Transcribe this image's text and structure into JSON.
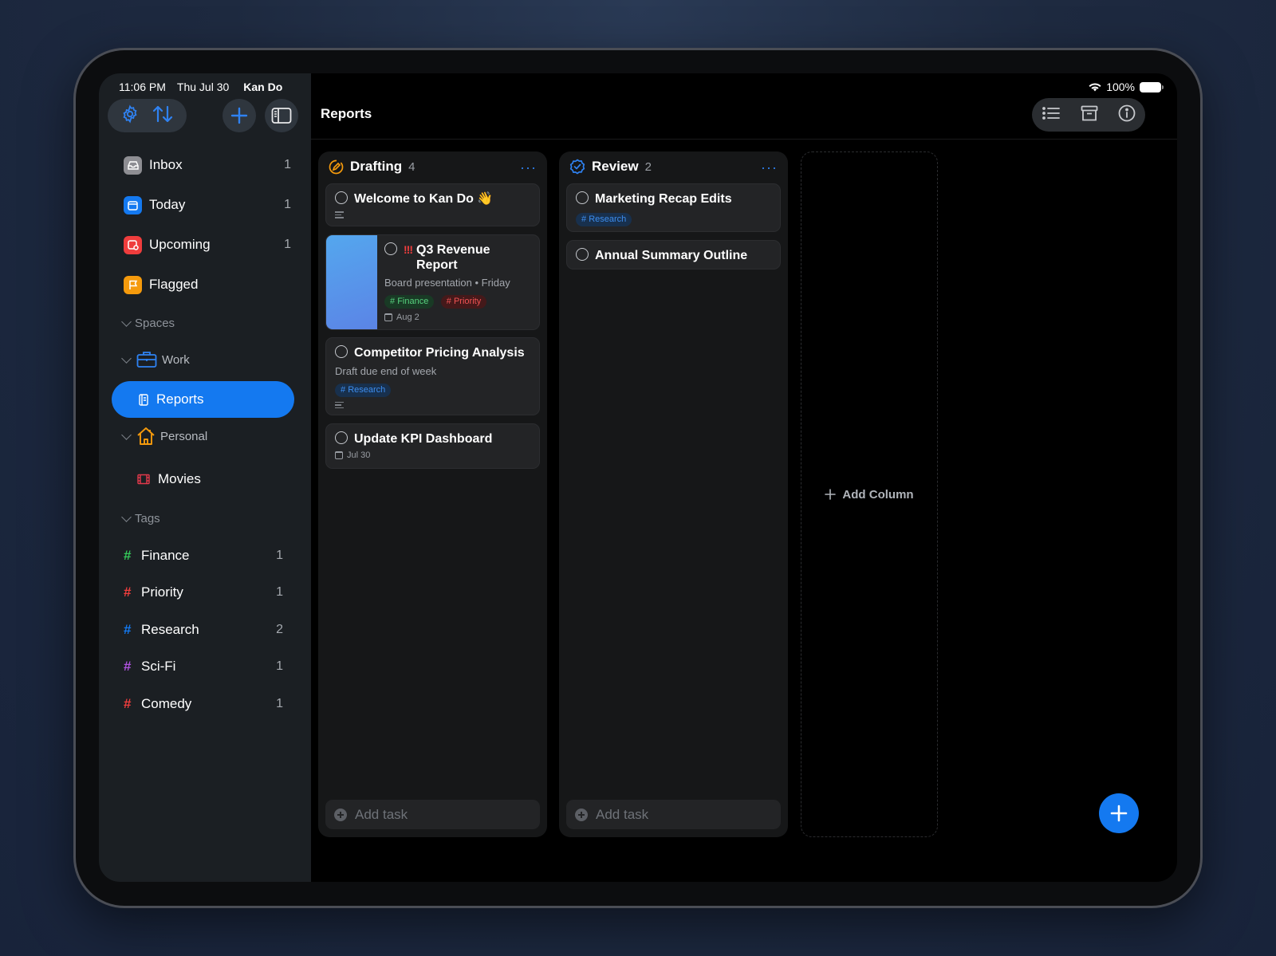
{
  "status_bar": {
    "time": "11:06 PM",
    "date": "Thu Jul 30",
    "app_name": "Kan Do",
    "battery": "100%"
  },
  "sidebar": {
    "smart_lists": [
      {
        "label": "Inbox",
        "count": "1",
        "icon": "inbox-icon",
        "color": "#8e8e93"
      },
      {
        "label": "Today",
        "count": "1",
        "icon": "calendar-icon",
        "color": "#1479f0"
      },
      {
        "label": "Upcoming",
        "count": "1",
        "icon": "calendar-clock-icon",
        "color": "#ef3d3d"
      },
      {
        "label": "Flagged",
        "count": "",
        "icon": "flag-icon",
        "color": "#f59a0c"
      }
    ],
    "spaces_header": "Spaces",
    "work": {
      "label": "Work",
      "icon": "briefcase-icon"
    },
    "reports": {
      "label": "Reports",
      "icon": "document-icon"
    },
    "personal": {
      "label": "Personal",
      "icon": "house-icon"
    },
    "movies": {
      "label": "Movies",
      "icon": "film-icon"
    },
    "tags_header": "Tags",
    "tags": [
      {
        "label": "Finance",
        "count": "1",
        "color": "#34c759"
      },
      {
        "label": "Priority",
        "count": "1",
        "color": "#ef3d3d"
      },
      {
        "label": "Research",
        "count": "2",
        "color": "#1479f0"
      },
      {
        "label": "Sci-Fi",
        "count": "1",
        "color": "#af52de"
      },
      {
        "label": "Comedy",
        "count": "1",
        "color": "#ef3d3d"
      }
    ]
  },
  "main": {
    "title": "Reports",
    "columns": [
      {
        "title": "Drafting",
        "count": "4",
        "add_task": "Add task",
        "cards": [
          {
            "title": "Welcome to Kan Do 👋"
          },
          {
            "title": "Q3 Revenue Report",
            "subtitle": "Board presentation • Friday",
            "tags": [
              "Finance",
              "Priority"
            ],
            "date": "Aug 2"
          },
          {
            "title": "Competitor Pricing Analysis",
            "subtitle": "Draft due end of week",
            "tags": [
              "Research"
            ]
          },
          {
            "title": "Update KPI Dashboard",
            "date": "Jul 30"
          }
        ]
      },
      {
        "title": "Review",
        "count": "2",
        "add_task": "Add task",
        "cards": [
          {
            "title": "Marketing Recap Edits",
            "tags": [
              "Research"
            ]
          },
          {
            "title": "Annual Summary Outline"
          }
        ]
      }
    ],
    "add_column": "Add Column"
  }
}
